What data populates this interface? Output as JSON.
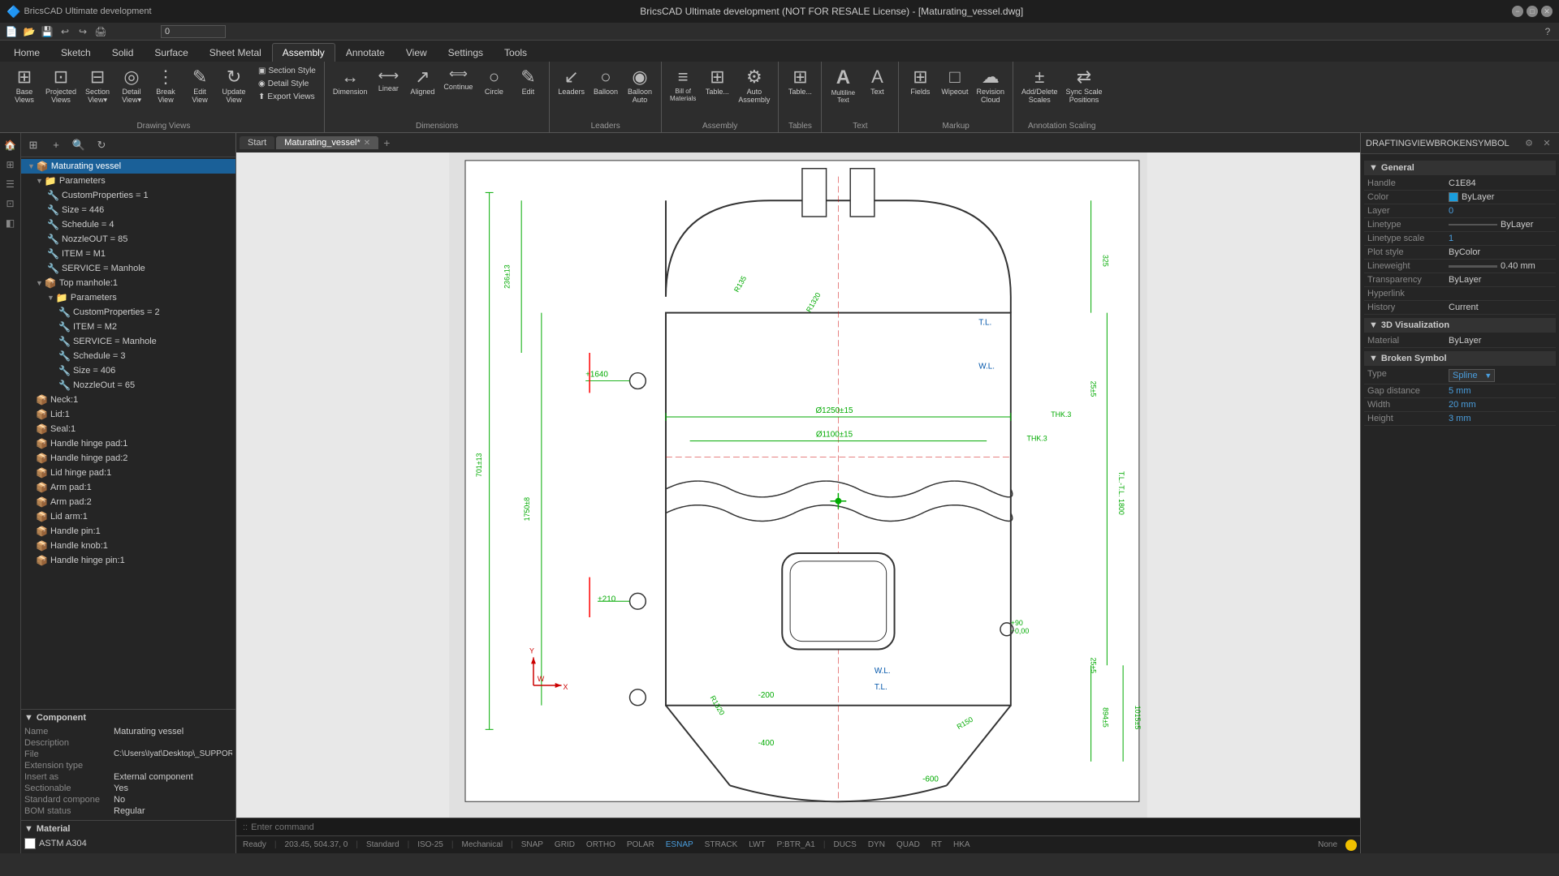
{
  "titleBar": {
    "title": "BricsCAD Ultimate development (NOT FOR RESALE License) - [Maturating_vessel.dwg]",
    "minimizeLabel": "−",
    "maximizeLabel": "□",
    "closeLabel": "✕"
  },
  "quickAccess": {
    "buttons": [
      "📁",
      "💾",
      "↩",
      "↪",
      "🖨",
      "⚡"
    ]
  },
  "ribbonTabs": [
    {
      "id": "home",
      "label": "Home"
    },
    {
      "id": "sketch",
      "label": "Sketch"
    },
    {
      "id": "solid",
      "label": "Solid"
    },
    {
      "id": "surface",
      "label": "Surface"
    },
    {
      "id": "sheetmetal",
      "label": "Sheet Metal"
    },
    {
      "id": "assembly",
      "label": "Assembly",
      "active": true
    },
    {
      "id": "annotate",
      "label": "Annotate"
    },
    {
      "id": "view",
      "label": "View"
    },
    {
      "id": "settings",
      "label": "Settings"
    },
    {
      "id": "tools",
      "label": "Tools"
    }
  ],
  "ribbon": {
    "groups": [
      {
        "id": "drawing-views",
        "label": "Drawing Views",
        "buttons": [
          {
            "id": "base-views",
            "icon": "⊞",
            "label": "Base\nViews"
          },
          {
            "id": "projected-views",
            "icon": "⊡",
            "label": "Projected\nViews"
          },
          {
            "id": "section",
            "icon": "⊟",
            "label": "Section\nView▾"
          },
          {
            "id": "detail",
            "icon": "◎",
            "label": "Detail\nView▾"
          },
          {
            "id": "break",
            "icon": "⋯",
            "label": "Break\nView"
          },
          {
            "id": "edit",
            "icon": "✎",
            "label": "Edit\nView"
          },
          {
            "id": "update",
            "icon": "↻",
            "label": "Update\nView"
          }
        ],
        "smallButtons": [
          {
            "id": "section-style",
            "label": "Section Style"
          },
          {
            "id": "detail-style",
            "label": "Detail Style"
          },
          {
            "id": "export-views",
            "label": "Export Views"
          }
        ]
      },
      {
        "id": "dimensions",
        "label": "Dimensions",
        "buttons": [
          {
            "id": "dimension",
            "icon": "↔",
            "label": "Dimension"
          },
          {
            "id": "linear",
            "icon": "⟷",
            "label": "Linear"
          },
          {
            "id": "aligned",
            "icon": "↗",
            "label": "Aligned"
          },
          {
            "id": "continue",
            "icon": "↔↔",
            "label": "Continue"
          },
          {
            "id": "circle",
            "icon": "○",
            "label": "Circle"
          },
          {
            "id": "edit-dim",
            "icon": "✎",
            "label": "Edit"
          }
        ]
      },
      {
        "id": "leaders",
        "label": "Leaders",
        "buttons": [
          {
            "id": "leaders",
            "icon": "↗",
            "label": "Leaders"
          },
          {
            "id": "balloon",
            "icon": "○",
            "label": "Balloon"
          },
          {
            "id": "balloon-auto",
            "icon": "◉",
            "label": "Balloon\nAuto"
          }
        ]
      },
      {
        "id": "assembly",
        "label": "Assembly",
        "buttons": [
          {
            "id": "bill-of-materials",
            "icon": "≡",
            "label": "Bill of\nMaterials"
          },
          {
            "id": "table",
            "icon": "⊞",
            "label": "Table..."
          },
          {
            "id": "auto-assembly",
            "icon": "⚙",
            "label": "Auto\nAssembly"
          }
        ]
      },
      {
        "id": "tables",
        "label": "Tables",
        "buttons": [
          {
            "id": "table-btn",
            "icon": "⊞",
            "label": "Table..."
          }
        ]
      },
      {
        "id": "text",
        "label": "Text",
        "buttons": [
          {
            "id": "multiline-text",
            "icon": "A",
            "label": "Multiline\nText"
          },
          {
            "id": "text",
            "icon": "A",
            "label": "Text"
          }
        ]
      },
      {
        "id": "markup",
        "label": "Markup",
        "buttons": [
          {
            "id": "fields",
            "icon": "⊞",
            "label": "Fields"
          },
          {
            "id": "wipeout",
            "icon": "□",
            "label": "Wipeout"
          },
          {
            "id": "revision-cloud",
            "icon": "☁",
            "label": "Revision\nCloud"
          }
        ]
      },
      {
        "id": "annotation-scaling",
        "label": "Annotation Scaling",
        "buttons": [
          {
            "id": "add-delete",
            "icon": "±",
            "label": "Add/Delete\nScales"
          },
          {
            "id": "sync-scale",
            "icon": "⇄",
            "label": "Sync Scale\nPositions"
          }
        ]
      }
    ]
  },
  "tabs": {
    "start": "Start",
    "drawing": "Maturating_vessel*",
    "addTab": "+"
  },
  "tree": {
    "rootItem": "Maturating vessel",
    "items": [
      {
        "id": "root",
        "label": "Maturating vessel",
        "level": 0,
        "expanded": true,
        "selected": true,
        "type": "root"
      },
      {
        "id": "params",
        "label": "Parameters",
        "level": 1,
        "expanded": true,
        "type": "folder"
      },
      {
        "id": "custprops",
        "label": "CustomProperties = 1",
        "level": 2,
        "type": "property"
      },
      {
        "id": "size",
        "label": "Size = 446",
        "level": 2,
        "type": "property"
      },
      {
        "id": "schedule",
        "label": "Schedule = 4",
        "level": 2,
        "type": "property"
      },
      {
        "id": "nozzleout",
        "label": "NozzleOUT = 85",
        "level": 2,
        "type": "property"
      },
      {
        "id": "item",
        "label": "ITEM = M1",
        "level": 2,
        "type": "property"
      },
      {
        "id": "service",
        "label": "SERVICE = Manhole",
        "level": 2,
        "type": "property"
      },
      {
        "id": "top-manhole",
        "label": "Top manhole:1",
        "level": 1,
        "expanded": true,
        "type": "component"
      },
      {
        "id": "params2",
        "label": "Parameters",
        "level": 2,
        "expanded": true,
        "type": "folder"
      },
      {
        "id": "custprops2",
        "label": "CustomProperties = 2",
        "level": 3,
        "type": "property"
      },
      {
        "id": "item2",
        "label": "ITEM = M2",
        "level": 3,
        "type": "property"
      },
      {
        "id": "service2",
        "label": "SERVICE = Manhole",
        "level": 3,
        "type": "property"
      },
      {
        "id": "schedule2",
        "label": "Schedule = 3",
        "level": 3,
        "type": "property"
      },
      {
        "id": "size2",
        "label": "Size = 406",
        "level": 3,
        "type": "property"
      },
      {
        "id": "nozzleout2",
        "label": "NozzleOut = 65",
        "level": 3,
        "type": "property"
      },
      {
        "id": "neck",
        "label": "Neck:1",
        "level": 1,
        "type": "component"
      },
      {
        "id": "lid",
        "label": "Lid:1",
        "level": 1,
        "type": "component"
      },
      {
        "id": "seal",
        "label": "Seal:1",
        "level": 1,
        "type": "component"
      },
      {
        "id": "handle-hinge-pad1",
        "label": "Handle hinge pad:1",
        "level": 1,
        "type": "component"
      },
      {
        "id": "handle-hinge-pad2",
        "label": "Handle hinge pad:2",
        "level": 1,
        "type": "component"
      },
      {
        "id": "lid-hinge-pad",
        "label": "Lid hinge pad:1",
        "level": 1,
        "type": "component"
      },
      {
        "id": "arm-pad1",
        "label": "Arm pad:1",
        "level": 1,
        "type": "component"
      },
      {
        "id": "arm-pad2",
        "label": "Arm pad:2",
        "level": 1,
        "type": "component"
      },
      {
        "id": "lid-arm",
        "label": "Lid arm:1",
        "level": 1,
        "type": "component"
      },
      {
        "id": "handle-pin",
        "label": "Handle pin:1",
        "level": 1,
        "type": "component"
      },
      {
        "id": "handle-knob",
        "label": "Handle knob:1",
        "level": 1,
        "type": "component"
      },
      {
        "id": "handle-hinge-pin",
        "label": "Handle hinge pin:1",
        "level": 1,
        "type": "component"
      }
    ]
  },
  "component": {
    "header": "Component",
    "fields": [
      {
        "label": "Name",
        "value": "Maturating vessel"
      },
      {
        "label": "Description",
        "value": ""
      },
      {
        "label": "File",
        "value": "C:\\Users\\Iyat\\Desktop\\_SUPPORT\\"
      },
      {
        "label": "Extension type",
        "value": ""
      },
      {
        "label": "Insert as",
        "value": "External component"
      },
      {
        "label": "Sectionable",
        "value": "Yes"
      },
      {
        "label": "Standard compone",
        "value": "No"
      },
      {
        "label": "BOM status",
        "value": "Regular"
      }
    ]
  },
  "material": {
    "header": "Material",
    "items": [
      {
        "label": "ASTM A304",
        "color": "#ffffff"
      }
    ]
  },
  "properties": {
    "header": "DRAFTINGVIEWBROKENSYMBOL",
    "sections": [
      {
        "id": "general",
        "label": "General",
        "rows": [
          {
            "label": "Handle",
            "value": "C1E84"
          },
          {
            "label": "Color",
            "value": "ByLayer",
            "colored": true
          },
          {
            "label": "Layer",
            "value": "0"
          },
          {
            "label": "Linetype",
            "value": "ByLayer"
          },
          {
            "label": "Linetype scale",
            "value": "1"
          },
          {
            "label": "Plot style",
            "value": "ByColor"
          },
          {
            "label": "Lineweight",
            "value": "0.40 mm"
          },
          {
            "label": "Transparency",
            "value": "ByLayer"
          },
          {
            "label": "Hyperlink",
            "value": ""
          },
          {
            "label": "History",
            "value": "Current"
          }
        ]
      },
      {
        "id": "3d-visualization",
        "label": "3D Visualization",
        "rows": [
          {
            "label": "Material",
            "value": "ByLayer"
          }
        ]
      },
      {
        "id": "broken-symbol",
        "label": "Broken Symbol",
        "rows": [
          {
            "label": "Type",
            "value": "Spline",
            "dropdown": true
          },
          {
            "label": "Gap distance",
            "value": "5 mm"
          },
          {
            "label": "Width",
            "value": "20 mm"
          },
          {
            "label": "Height",
            "value": "3 mm"
          }
        ]
      }
    ]
  },
  "statusBar": {
    "ready": "Ready",
    "coordinates": "203.45, 504.37, 0",
    "standard": "Standard",
    "iso": "ISO-25",
    "mechanical": "Mechanical",
    "snap": "SNAP",
    "grid": "GRID",
    "ortho": "ORTHO",
    "polar": "POLAR",
    "esnap": "ESNAP",
    "strack": "STRACK",
    "lwt": "LWT",
    "layer": "P:BTR_A1",
    "ducs": "DUCS",
    "dyn": "DYN",
    "quad": "QUAD",
    "rt": "RT",
    "hka": "HKA",
    "none": "None"
  },
  "commandLine": {
    "prompt": "Enter command"
  }
}
